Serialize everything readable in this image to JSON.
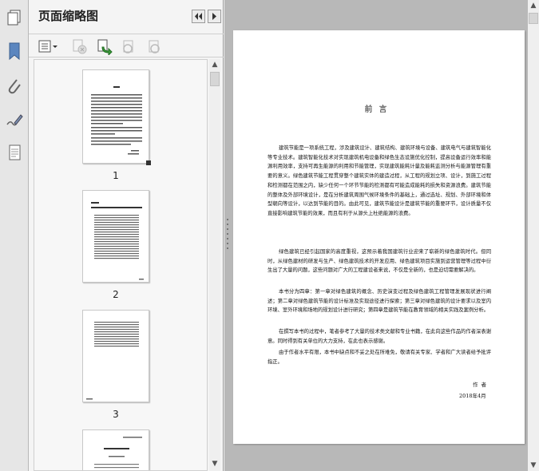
{
  "thumbnail_panel": {
    "title": "页面缩略图",
    "pages": [
      {
        "label": "1"
      },
      {
        "label": "2"
      },
      {
        "label": "3"
      }
    ]
  },
  "icons": {
    "nav": [
      "copy-pages-icon",
      "bookmark-icon",
      "attachment-icon",
      "signature-icon",
      "layers-icon"
    ],
    "header": [
      "collapse-left-icon",
      "expand-right-icon"
    ],
    "toolbar": [
      "thumbnail-options-icon",
      "delete-page-icon",
      "insert-page-icon",
      "undo-icon",
      "redo-icon"
    ]
  },
  "document": {
    "heading": "前言",
    "paragraphs": [
      "建筑节能是一项系统工程，涉及建筑设计、建筑结构、建筑环境与设备、建筑电气与建筑智能化等专业技术。建筑智能化技术对实现建筑机电设备和绿色生态设施优化控制，提高设备运行效率和能源利用效率，支持可再生能源的利用和节能管理，实现建筑能耗计量及能耗监测分析与能源管理有重要的意义。绿色建筑节能工程贯穿整个建筑实体的建造过程，从工程的规划立项、设计，到施工过程和检测都在范围之内，缺少任何一个环节节能的检测都有可能造成能耗的损失和资源浪费。建筑节能的整体及外部环境设计，是在分析建筑周围气候环境条件的基础上，通过选址、规划、外部环境和体型朝向等设计，以达到节能的目的。由此可见，建筑节能设计是建筑节能的重要环节，设计质量不仅直接影响建筑节能的效果，而且有利于从源头上杜绝能源的浪费。",
      "绿色建筑已经引起国家的高度重视，这预示着我国建筑行业迎来了崭新的绿色建筑时代。但同时，从绿色建材的研发与生产、绿色建筑技术的开发应用、绿色建筑项目实施到运营管理等过程中衍生出了大量的问题，这些问题对广大的工程建设者来说，不仅是全新的，也是迫切需要解决的。",
      "本书分为四章：第一章对绿色建筑的概念、历史演变过程及绿色建筑工程管理发展现状进行阐述；第二章对绿色建筑节能的设计标准及实现途径进行探索；第三章对绿色建筑的设计要求以及室内环境、室外环境和场地的规划设计进行研究；第四章是建筑节能在教育领域的相关实践及案例分析。",
      "在撰写本书的过程中，笔者参考了大量的技术类文献和专业书籍，在此向这些作品的作者深表谢意。同时得到有关单位的大力支持，在此也表示感谢。",
      "由于作者水平有限，本书中缺点和不妥之处在所难免，敬请有关专家、学者和广大读者给予批评指正。"
    ],
    "signature": "作者",
    "date": "2018年4月"
  }
}
